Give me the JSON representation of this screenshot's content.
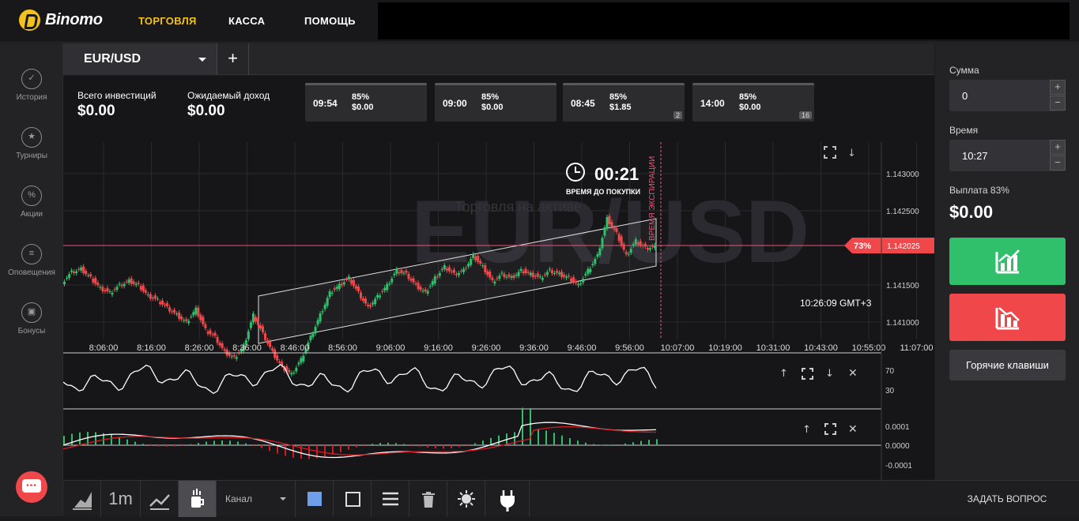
{
  "brand": {
    "name": "Binomo"
  },
  "nav": [
    {
      "label": "ТОРГОВЛЯ",
      "active": true
    },
    {
      "label": "КАССА"
    },
    {
      "label": "ПОМОЩЬ"
    }
  ],
  "sidebar": {
    "items": [
      {
        "label": "История",
        "icon": "check-circle-icon"
      },
      {
        "label": "Турниры",
        "icon": "trophy-icon"
      },
      {
        "label": "Акции",
        "icon": "percent-icon"
      },
      {
        "label": "Оповещения",
        "icon": "list-icon"
      },
      {
        "label": "Бонусы",
        "icon": "gift-icon"
      }
    ]
  },
  "asset_tab": {
    "name": "EUR/USD",
    "add": "+"
  },
  "summary": {
    "invest_label": "Всего инвестиций",
    "invest_value": "$0.00",
    "income_label": "Ожидаемый доход",
    "income_value": "$0.00"
  },
  "deals": [
    {
      "time": "09:54",
      "pct": "85%",
      "amount": "$0.00",
      "count": ""
    },
    {
      "time": "09:00",
      "pct": "85%",
      "amount": "$0.00",
      "count": ""
    },
    {
      "time": "08:45",
      "pct": "85%",
      "amount": "$1.85",
      "count": "2"
    },
    {
      "time": "14:00",
      "pct": "85%",
      "amount": "$0.00",
      "count": "16"
    }
  ],
  "timer": {
    "value": "00:21",
    "label": "ВРЕМЯ ДО ПОКУПКИ"
  },
  "watermark": {
    "asset": "EUR/USD",
    "hint": "Торговля на активе"
  },
  "expiry_label": "ВРЕМЯ ЭКСПИРАЦИИ",
  "price_marker": {
    "pct": "73%",
    "price": "1.142025"
  },
  "clock": "10:26:09 GMT+3",
  "chart_data": {
    "type": "line",
    "title": "",
    "y_ticks": [
      "1.143000",
      "1.142500",
      "1.141500",
      "1.141000"
    ],
    "x_ticks": [
      "8:06:00",
      "8:16:00",
      "8:26:00",
      "8:36:00",
      "8:46:00",
      "8:56:00",
      "9:06:00",
      "9:16:00",
      "9:26:00",
      "9:36:00",
      "9:46:00",
      "9:56:00",
      "10:07:00",
      "10:19:00",
      "10:31:00",
      "10:43:00",
      "10:55:00",
      "11:07:00"
    ],
    "series": [
      {
        "values": [
          1.14154,
          1.14168,
          1.14172,
          1.1416,
          1.14146,
          1.1414,
          1.1415,
          1.14156,
          1.1415,
          1.14136,
          1.1413,
          1.1412,
          1.1411,
          1.141,
          1.14118,
          1.1409,
          1.1408,
          1.1406,
          1.14052,
          1.14068,
          1.1411,
          1.14085,
          1.1406,
          1.1404,
          1.1403,
          1.1405,
          1.1408,
          1.1411,
          1.1414,
          1.1415,
          1.1416,
          1.1414,
          1.1412,
          1.14135,
          1.1415,
          1.1417,
          1.14165,
          1.1415,
          1.1414,
          1.1416,
          1.14175,
          1.14165,
          1.1417,
          1.1419,
          1.14175,
          1.14155,
          1.14165,
          1.1416,
          1.1417,
          1.14165,
          1.1416,
          1.1417,
          1.14165,
          1.1416,
          1.1415,
          1.1417,
          1.1419,
          1.1424,
          1.1422,
          1.1419,
          1.1421,
          1.142,
          1.14202
        ]
      }
    ],
    "rsi": {
      "levels": [
        "70",
        "30"
      ]
    },
    "macd": {
      "levels": [
        "0.0001",
        "0.0000",
        "-0.0001"
      ]
    }
  },
  "right": {
    "amount_label": "Сумма",
    "amount_value": "0",
    "time_label": "Время",
    "time_value": "10:27",
    "payout_label": "Выплата 83%",
    "payout_value": "$0.00",
    "hotkeys": "Горячие клавиши",
    "ask": "ЗАДАТЬ ВОПРОС"
  },
  "toolbar": {
    "interval": "1m",
    "indicator": "Канал"
  },
  "colors": {
    "up": "#30c06b",
    "down": "#f0484a",
    "accent": "#f3c11b",
    "expiry": "#e8567b"
  }
}
